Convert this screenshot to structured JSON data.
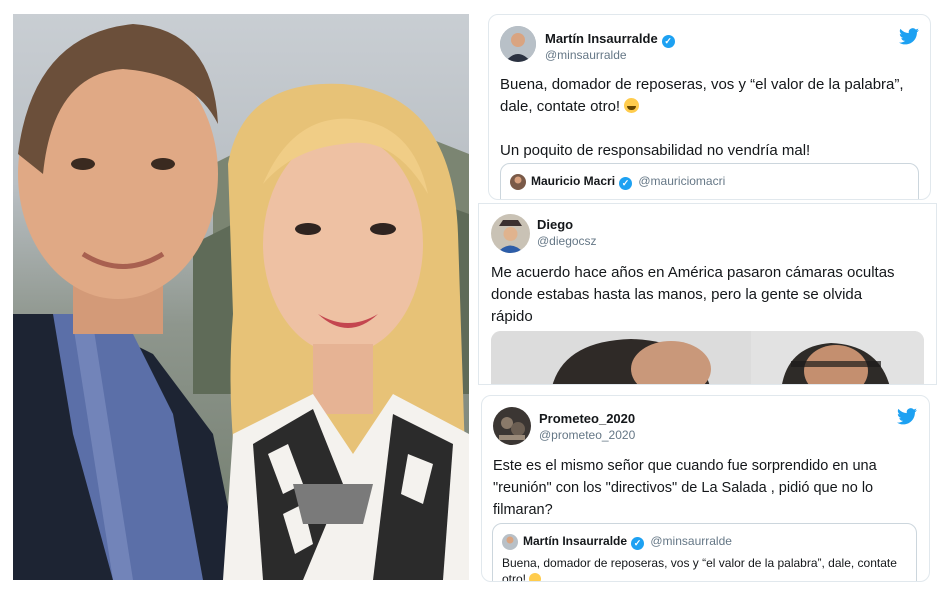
{
  "tweets": [
    {
      "name": "Martín Insaurralde",
      "handle": "@minsaurralde",
      "text_line1": "Buena, domador de reposeras, vos y “el valor de la palabra”,",
      "text_line2": "dale, contate otro!",
      "text_line3": "Un poquito de responsabilidad no vendría mal!",
      "quote": {
        "name": "Mauricio Macri",
        "handle": "@mauriciomacri"
      }
    },
    {
      "name": "Diego",
      "handle": "@diegocsz",
      "text_line1": "Me acuerdo hace años en América pasaron cámaras ocultas",
      "text_line2": "donde estabas hasta las manos, pero la gente se olvida",
      "text_line3": "rápido"
    },
    {
      "name": "Prometeo_2020",
      "handle": "@prometeo_2020",
      "text_line1": "Este es el mismo señor que cuando fue sorprendido en una",
      "text_line2": "\"reunión\" con los \"directivos\" de La Salada , pidió que no lo",
      "text_line3": "filmaran?",
      "quote": {
        "name": "Martín Insaurralde",
        "handle": "@minsaurralde",
        "text_line1": "Buena, domador de reposeras, vos y “el valor de la palabra”, dale, contate",
        "text_line2": "otro!"
      }
    }
  ],
  "colors": {
    "twitter_blue": "#1da1f2",
    "text": "#14171a",
    "muted": "#657786"
  }
}
